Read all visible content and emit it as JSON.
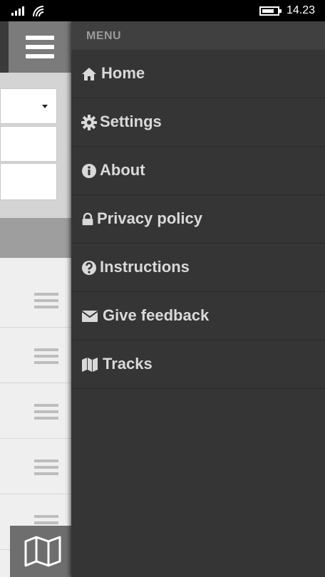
{
  "status_bar": {
    "time": "14.23",
    "signal_icon": "signal-bars-icon",
    "wifi_icon": "wifi-icon",
    "battery_icon": "battery-icon"
  },
  "background_app": {
    "menu_button_icon": "hamburger-icon",
    "map_button_icon": "map-icon",
    "list_handle_icon": "drag-handle-icon"
  },
  "drawer": {
    "title": "MENU",
    "items": [
      {
        "label": "Home",
        "icon": "home-icon"
      },
      {
        "label": "Settings",
        "icon": "gear-icon"
      },
      {
        "label": "About",
        "icon": "info-icon"
      },
      {
        "label": "Privacy policy",
        "icon": "lock-icon"
      },
      {
        "label": "Instructions",
        "icon": "question-icon"
      },
      {
        "label": "Give feedback",
        "icon": "envelope-icon"
      },
      {
        "label": "Tracks",
        "icon": "map-icon"
      }
    ]
  },
  "colors": {
    "drawer_bg": "#353535",
    "drawer_header_bg": "#404040",
    "menu_text": "#d9d9d9",
    "menu_header_text": "#9a9a9a"
  }
}
